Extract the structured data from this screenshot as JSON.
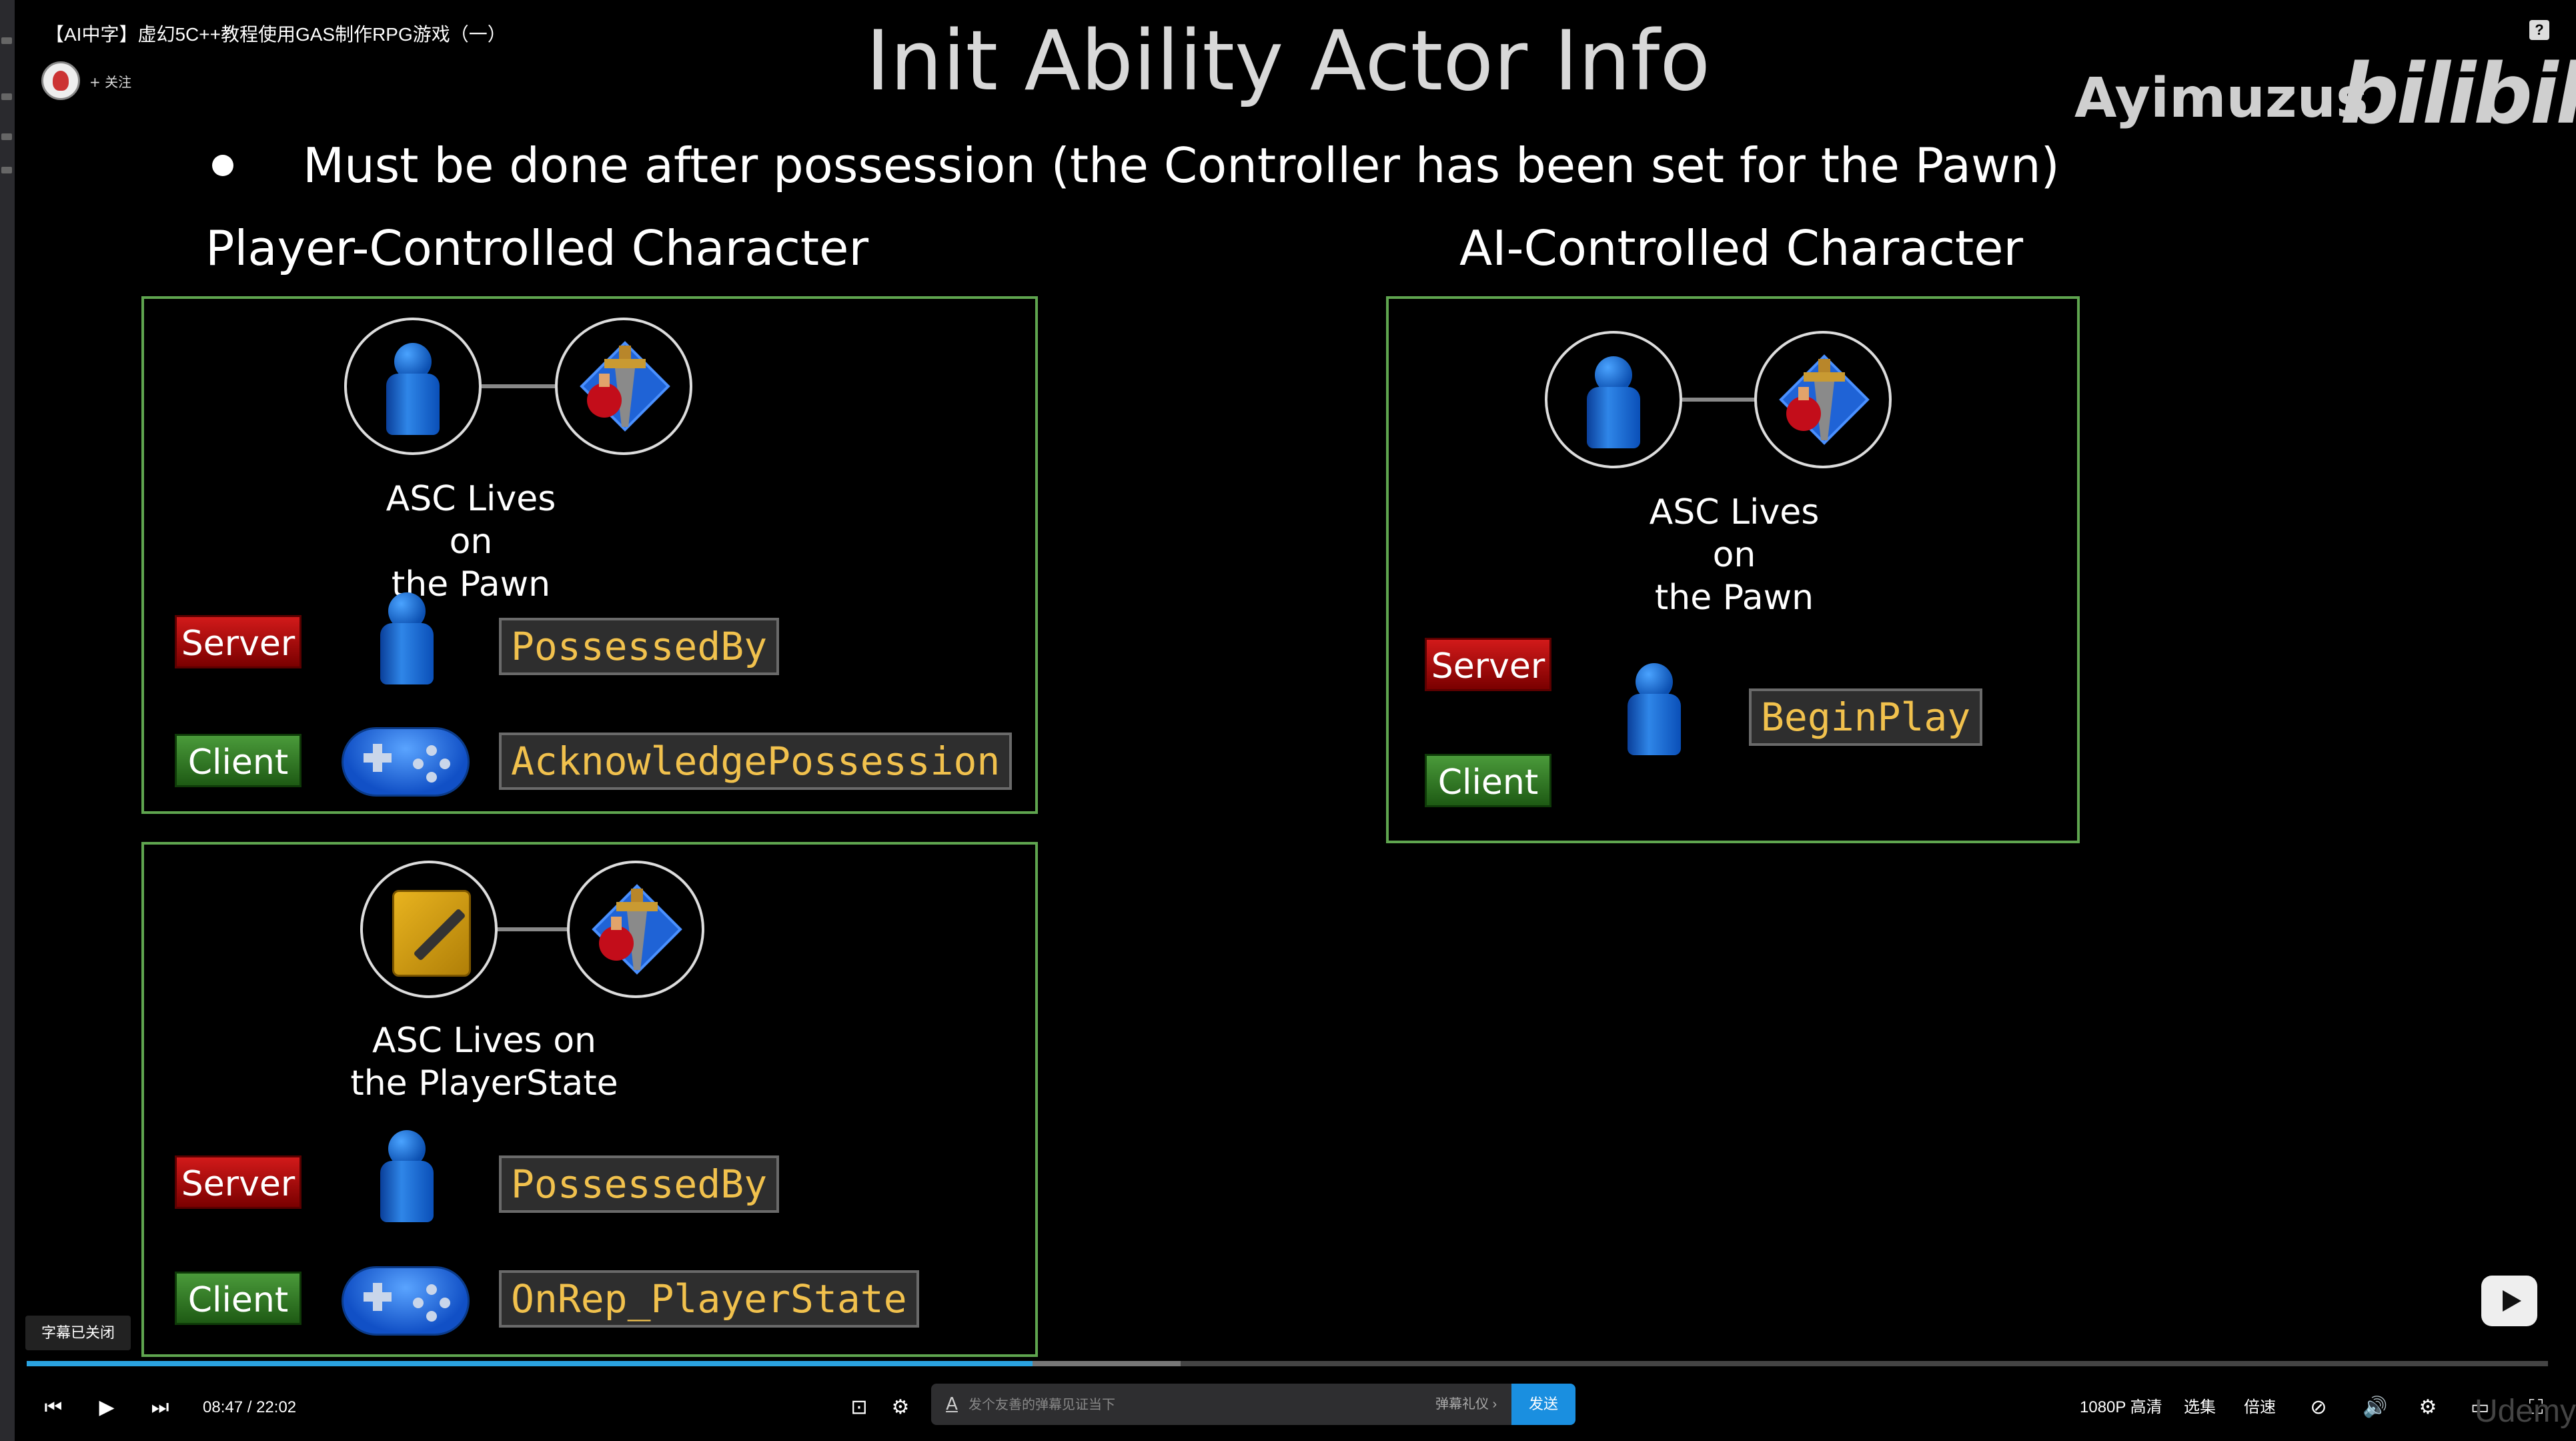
{
  "video_title": "【AI中字】虚幻5C++教程使用GAS制作RPG游戏（一）",
  "uploader": {
    "follow_label": "+ 关注"
  },
  "slide": {
    "title": "Init Ability Actor Info",
    "bullet": "Must be done after possession (the Controller has been set for the Pawn)",
    "watermark_name": "Ayimuzus",
    "watermark_logo": "bilibili",
    "player_heading": "Player-Controlled Character",
    "ai_heading": "AI-Controlled Character",
    "player_pawn": {
      "asc_label_1": "ASC Lives on",
      "asc_label_2": "the Pawn",
      "server_tag": "Server",
      "client_tag": "Client",
      "server_func": "PossessedBy",
      "client_func": "AcknowledgePossession"
    },
    "player_state": {
      "asc_label_1": "ASC Lives on",
      "asc_label_2": "the PlayerState",
      "server_tag": "Server",
      "client_tag": "Client",
      "server_func": "PossessedBy",
      "client_func": "OnRep_PlayerState"
    },
    "ai_pawn": {
      "asc_label_1": "ASC Lives on",
      "asc_label_2": "the Pawn",
      "server_tag": "Server",
      "client_tag": "Client",
      "func": "BeginPlay"
    }
  },
  "player": {
    "subtitles_status": "字幕已关闭",
    "current_time": "08:47",
    "time_separator": "/",
    "duration": "22:02",
    "progress_fraction": 0.399,
    "danmaku_placeholder": "发个友善的弹幕见证当下",
    "danmaku_etiquette": "弹幕礼仪 ›",
    "send_label": "发送",
    "quality_label": "1080P 高清",
    "episodes_label": "选集",
    "speed_label": "倍速",
    "watermark_udemy": "Udemy",
    "accent_color": "#2aa3e0"
  }
}
